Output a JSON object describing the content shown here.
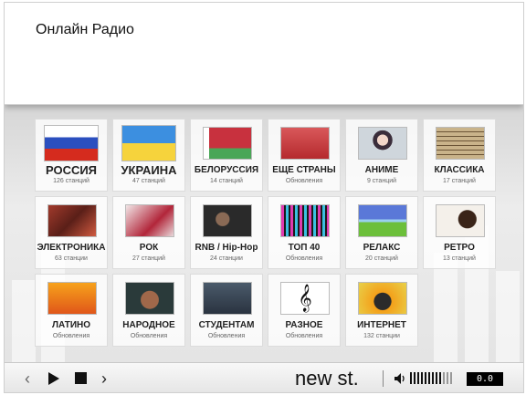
{
  "header": {
    "title": "Онлайн Радио"
  },
  "tiles": [
    {
      "name": "РОССИЯ",
      "sub": "126 станций",
      "thumb": "russia-flag"
    },
    {
      "name": "УКРАИНА",
      "sub": "47 станций",
      "thumb": "ukraine-flag"
    },
    {
      "name": "БЕЛОРУССИЯ",
      "sub": "14 станций",
      "thumb": "belarus-flag"
    },
    {
      "name": "ЕЩЕ СТРАНЫ",
      "sub": "Обновления",
      "thumb": "other-countries"
    },
    {
      "name": "АНИМЕ",
      "sub": "9 станций",
      "thumb": "anime"
    },
    {
      "name": "КЛАССИКА",
      "sub": "17 станций",
      "thumb": "classical"
    },
    {
      "name": "ЭЛЕКТРОНИКА",
      "sub": "63 станции",
      "thumb": "electronic"
    },
    {
      "name": "РОК",
      "sub": "27 станций",
      "thumb": "rock"
    },
    {
      "name": "RNB / Hip-Hop",
      "sub": "24 станции",
      "thumb": "rnb"
    },
    {
      "name": "ТОП 40",
      "sub": "Обновления",
      "thumb": "top40"
    },
    {
      "name": "РЕЛАКС",
      "sub": "20 станций",
      "thumb": "relax"
    },
    {
      "name": "РЕТРО",
      "sub": "13 станций",
      "thumb": "retro"
    },
    {
      "name": "ЛАТИНО",
      "sub": "Обновления",
      "thumb": "latino"
    },
    {
      "name": "НАРОДНОЕ",
      "sub": "Обновления",
      "thumb": "folk"
    },
    {
      "name": "СТУДЕНТАМ",
      "sub": "Обновления",
      "thumb": "students"
    },
    {
      "name": "РАЗНОЕ",
      "sub": "Обновления",
      "thumb": "misc"
    },
    {
      "name": "ИНТЕРНЕТ",
      "sub": "132 станции",
      "thumb": "internet"
    }
  ],
  "player": {
    "prev_icon": "‹",
    "next_icon": "›",
    "station": "new st.",
    "volume_level": 0.75,
    "level_readout": "0.0"
  },
  "colors": {
    "accent": "#111111",
    "background": "#e8e8e8"
  }
}
